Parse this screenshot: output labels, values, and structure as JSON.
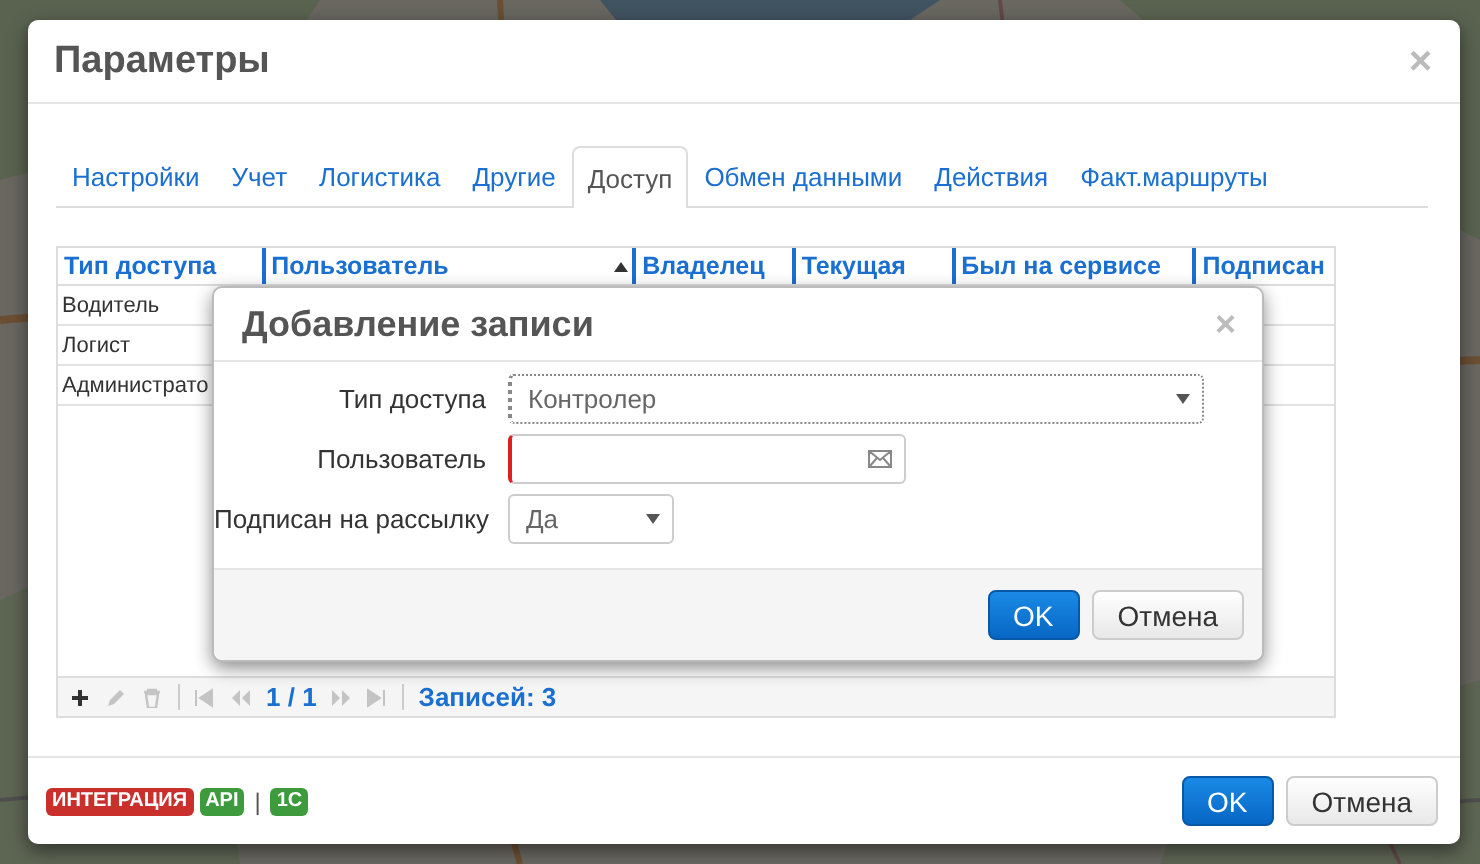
{
  "dialog": {
    "title": "Параметры",
    "close": "×",
    "tabs": [
      {
        "label": "Настройки",
        "selected": false
      },
      {
        "label": "Учет",
        "selected": false
      },
      {
        "label": "Логистика",
        "selected": false
      },
      {
        "label": "Другие",
        "selected": false
      },
      {
        "label": "Доступ",
        "selected": true
      },
      {
        "label": "Обмен данными",
        "selected": false
      },
      {
        "label": "Действия",
        "selected": false
      },
      {
        "label": "Факт.маршруты",
        "selected": false
      }
    ],
    "grid": {
      "columns": [
        {
          "label": "Тип доступа",
          "sorted": false
        },
        {
          "label": "Пользователь",
          "sorted": true
        },
        {
          "label": "Владелец",
          "sorted": false
        },
        {
          "label": "Текущая",
          "sorted": false
        },
        {
          "label": "Был на сервисе",
          "sorted": false
        },
        {
          "label": "Подписан",
          "sorted": false
        }
      ],
      "rows": [
        [
          "Водитель"
        ],
        [
          "Логист"
        ],
        [
          "Администрато"
        ]
      ],
      "tools": [
        {
          "kind": "add",
          "disabled": false
        },
        {
          "kind": "edit",
          "disabled": true
        },
        {
          "kind": "delete",
          "disabled": true
        }
      ],
      "nav_back": [
        {
          "kind": "first",
          "disabled": true
        },
        {
          "kind": "prev",
          "disabled": true
        }
      ],
      "page": "1 / 1",
      "nav_forward": [
        {
          "kind": "next",
          "disabled": true
        },
        {
          "kind": "last",
          "disabled": true
        }
      ],
      "records": "Записей: 3"
    },
    "badges": [
      {
        "kind": "badge",
        "label": "ИНТЕГРАЦИЯ",
        "color": "#c9302c"
      },
      {
        "kind": "badge",
        "label": "API",
        "color": "#3d9b3d"
      },
      {
        "kind": "separator",
        "label": "|"
      },
      {
        "kind": "badge",
        "label": "1C",
        "color": "#3d9b3d"
      }
    ],
    "buttons": [
      {
        "label": "OK",
        "kind": "primary"
      },
      {
        "label": "Отмена",
        "kind": "default"
      }
    ]
  },
  "modal": {
    "title": "Добавление записи",
    "close": "×",
    "fields": [
      {
        "label": "Тип доступа",
        "kind": "select",
        "value": "Контролер",
        "required": true
      },
      {
        "label": "Пользователь",
        "kind": "email",
        "required": true
      },
      {
        "label": "Подписан на рассылку",
        "kind": "select",
        "value": "Да",
        "required": false
      }
    ],
    "buttons": [
      {
        "label": "OK",
        "kind": "primary"
      },
      {
        "label": "Отмена",
        "kind": "default"
      }
    ]
  }
}
